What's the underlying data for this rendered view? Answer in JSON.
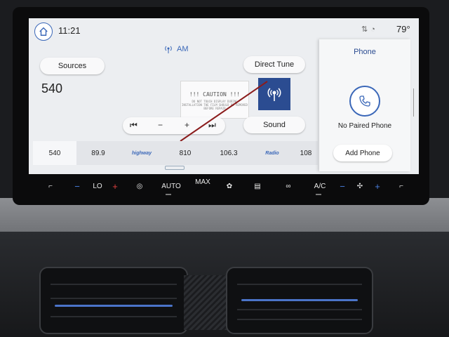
{
  "status": {
    "time": "11:21",
    "temperature": "79°"
  },
  "radio": {
    "band": "AM",
    "frequency": "540",
    "sources_label": "Sources",
    "direct_tune_label": "Direct Tune",
    "sound_label": "Sound",
    "caution_text": "!!! CAUTION !!!",
    "caution_fine_print": "DO NOT TOUCH DISPLAY DURING INSTALLATION THE FILM SHOULD BE REMOVED BEFORE REPAIR",
    "controls": {
      "prev": "⏮",
      "minus": "−",
      "plus": "+",
      "next": "⏭"
    },
    "presets": [
      "540",
      "89.9",
      "highway",
      "810",
      "106.3",
      "Radio",
      "108"
    ]
  },
  "phone": {
    "title": "Phone",
    "status": "No Paired Phone",
    "add_label": "Add Phone"
  },
  "climate": {
    "left_temp": "LO",
    "auto_label": "AUTO",
    "max_label": "MAX",
    "ac_label": "A/C",
    "minus": "−",
    "plus": "+"
  },
  "colors": {
    "accent": "#3a67b8",
    "station_art": "#2b4c91",
    "ambient_led": "#4b74c9"
  }
}
